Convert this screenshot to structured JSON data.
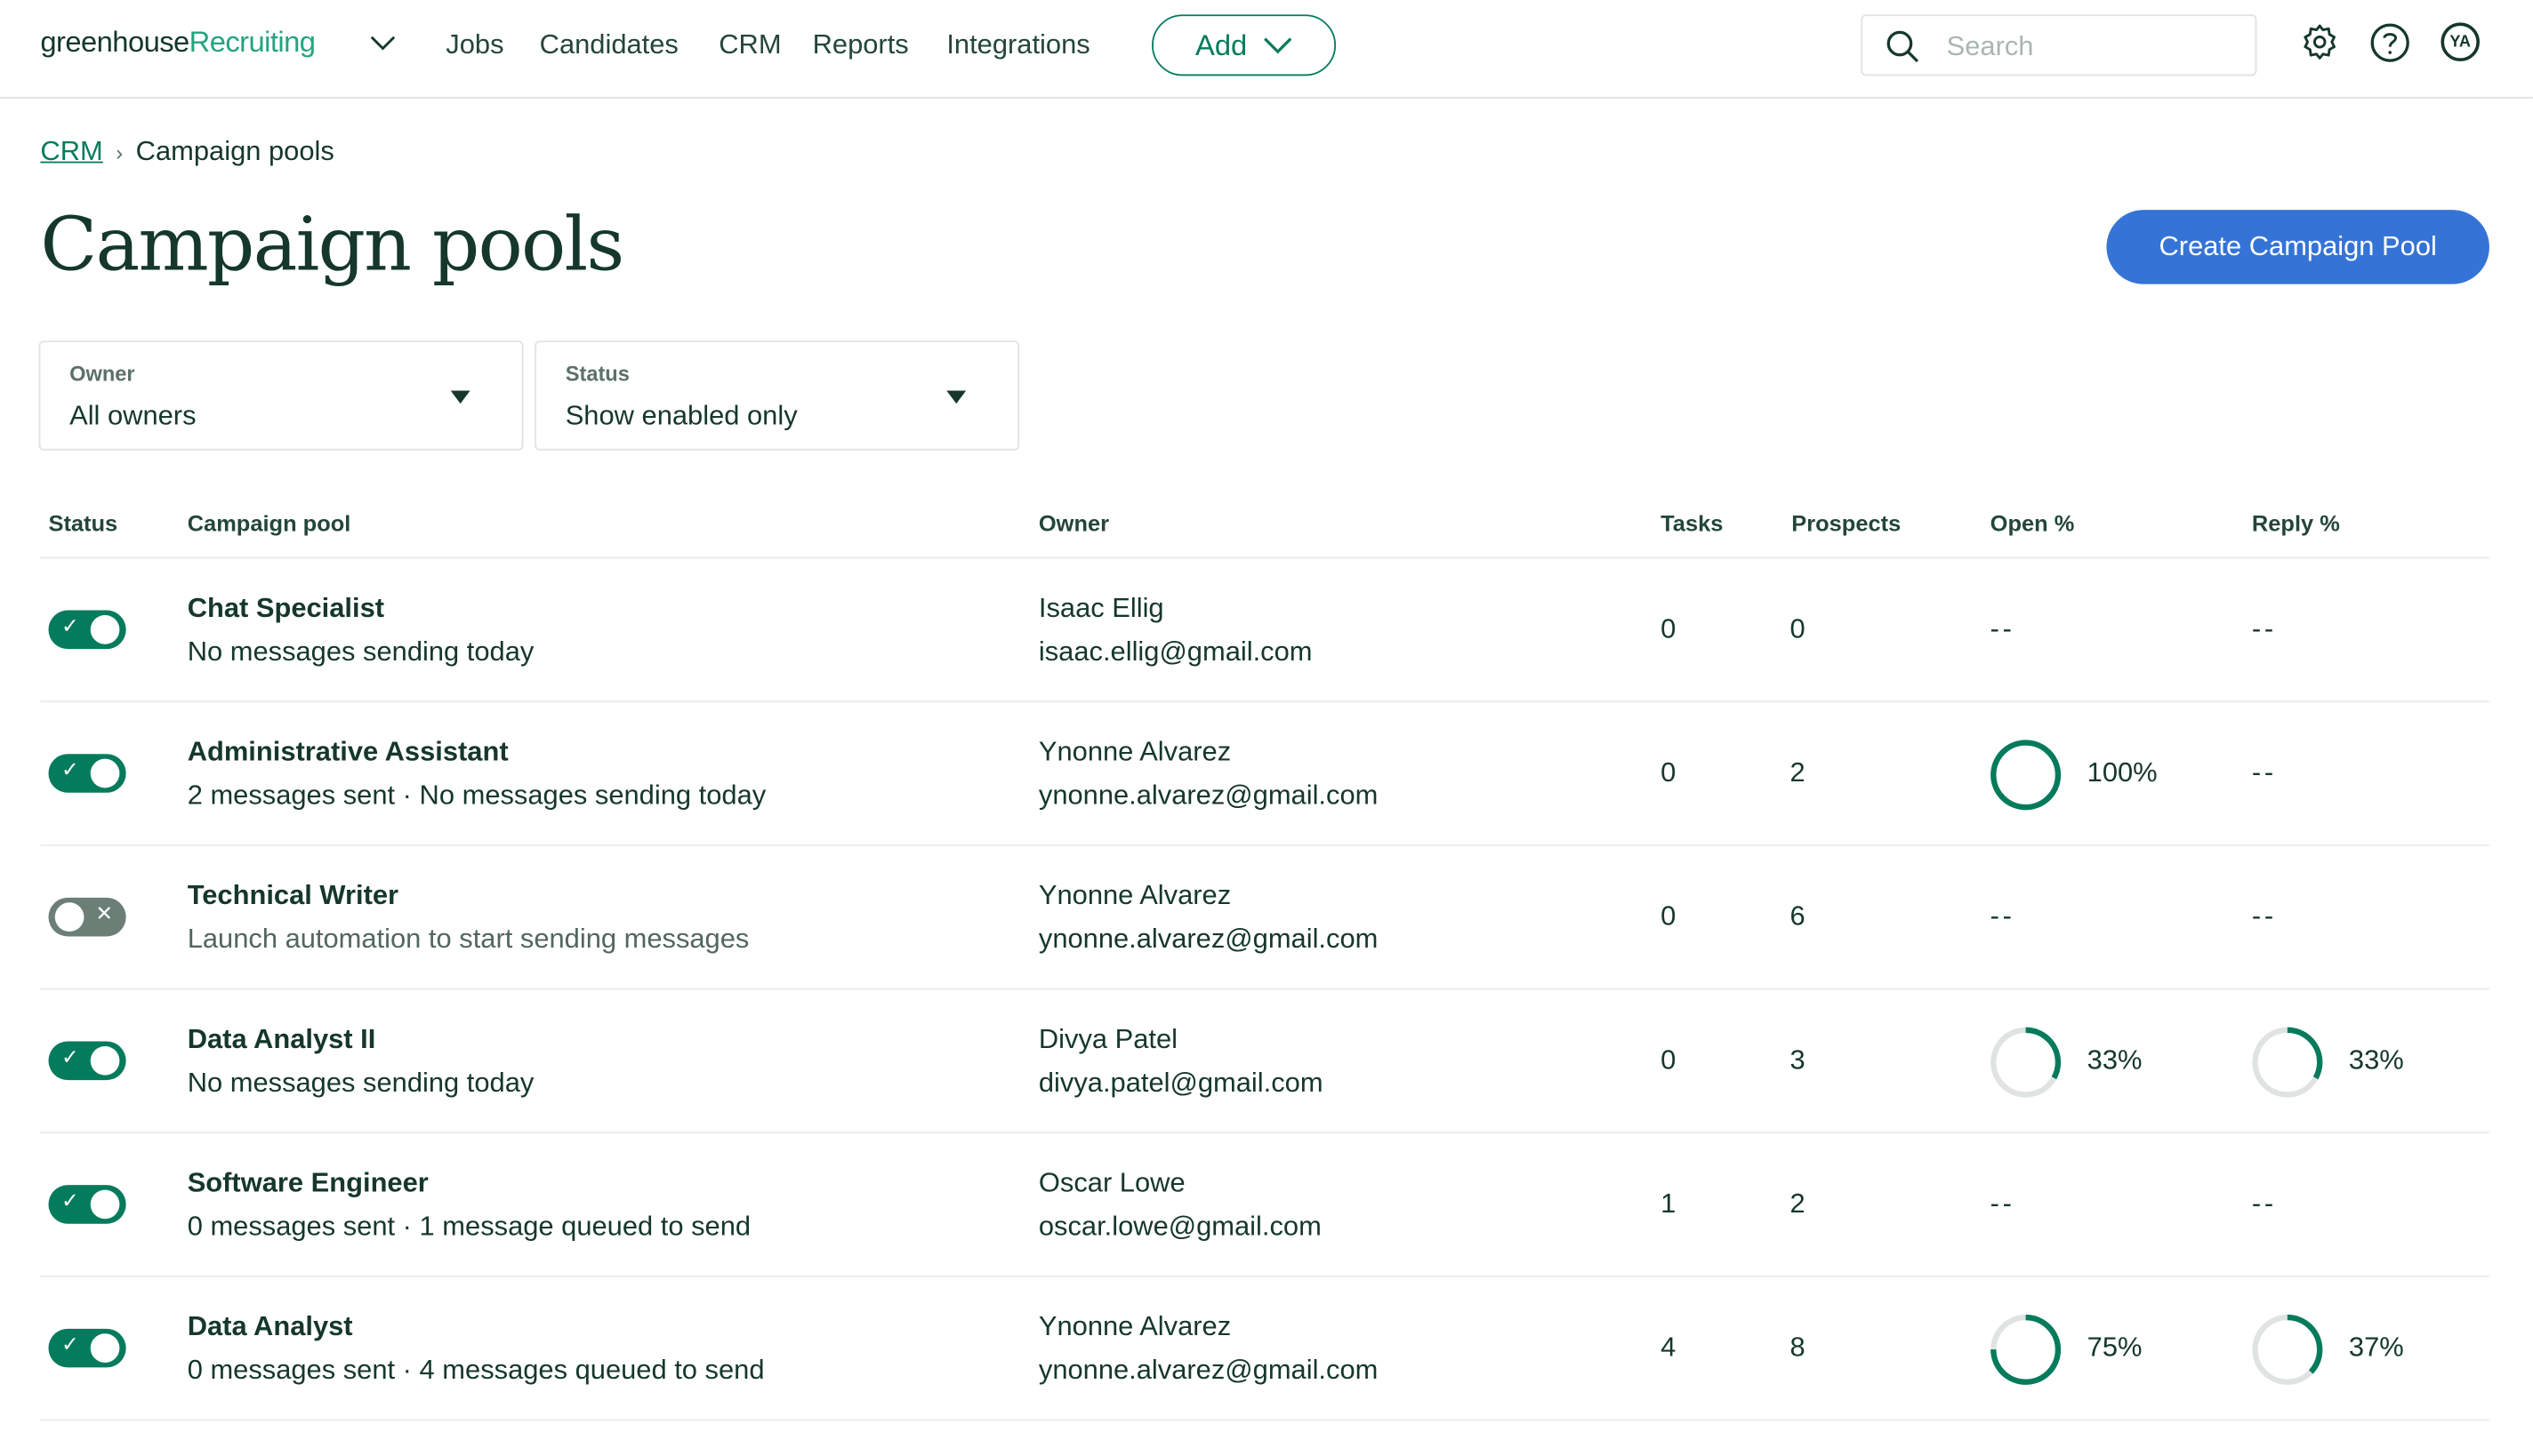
{
  "header": {
    "logo_primary": "greenhouse",
    "logo_secondary": "Recruiting",
    "nav": [
      "Jobs",
      "Candidates",
      "CRM",
      "Reports",
      "Integrations"
    ],
    "add_label": "Add",
    "search_placeholder": "Search",
    "avatar_initials": "YA",
    "icons": [
      "gear-icon",
      "help-icon"
    ]
  },
  "breadcrumb": {
    "parent": "CRM",
    "separator": "›",
    "current": "Campaign pools"
  },
  "page": {
    "title": "Campaign pools",
    "create_label": "Create Campaign Pool"
  },
  "filters": [
    {
      "label": "Owner",
      "value": "All owners"
    },
    {
      "label": "Status",
      "value": "Show enabled only"
    }
  ],
  "table": {
    "columns": [
      "Status",
      "Campaign pool",
      "Owner",
      "Tasks",
      "Prospects",
      "Open %",
      "Reply %"
    ],
    "rows": [
      {
        "enabled": true,
        "name": "Chat Specialist",
        "detail": "No messages sending today",
        "owner": "Isaac Ellig",
        "email": "isaac.ellig@gmail.com",
        "tasks": "0",
        "prospects": "0",
        "open": null,
        "open_label": "--",
        "reply": null,
        "reply_label": "--"
      },
      {
        "enabled": true,
        "name": "Administrative Assistant",
        "detail": "2 messages sent · No messages sending today",
        "owner": "Ynonne Alvarez",
        "email": "ynonne.alvarez@gmail.com",
        "tasks": "0",
        "prospects": "2",
        "open": 100,
        "open_label": "100%",
        "reply": null,
        "reply_label": "--"
      },
      {
        "enabled": false,
        "name": "Technical Writer",
        "detail": "Launch automation to start sending messages",
        "owner": "Ynonne Alvarez",
        "email": "ynonne.alvarez@gmail.com",
        "tasks": "0",
        "prospects": "6",
        "open": null,
        "open_label": "--",
        "reply": null,
        "reply_label": "--"
      },
      {
        "enabled": true,
        "name": "Data Analyst II",
        "detail": "No messages sending today",
        "owner": "Divya Patel",
        "email": "divya.patel@gmail.com",
        "tasks": "0",
        "prospects": "3",
        "open": 33,
        "open_label": "33%",
        "reply": 33,
        "reply_label": "33%"
      },
      {
        "enabled": true,
        "name": "Software Engineer",
        "detail": "0 messages sent · 1 message queued to send",
        "owner": "Oscar Lowe",
        "email": "oscar.lowe@gmail.com",
        "tasks": "1",
        "prospects": "2",
        "open": null,
        "open_label": "--",
        "reply": null,
        "reply_label": "--"
      },
      {
        "enabled": true,
        "name": "Data Analyst",
        "detail": "0 messages sent · 4 messages queued to send",
        "owner": "Ynonne Alvarez",
        "email": "ynonne.alvarez@gmail.com",
        "tasks": "4",
        "prospects": "8",
        "open": 75,
        "open_label": "75%",
        "reply": 37,
        "reply_label": "37%"
      }
    ]
  },
  "colors": {
    "brand_green": "#047b5c",
    "logo_green": "#24a47f",
    "primary_blue": "#3574d6",
    "text": "#15372c",
    "ring_track": "#dfe3e2",
    "toggle_off": "#6b7f77"
  }
}
